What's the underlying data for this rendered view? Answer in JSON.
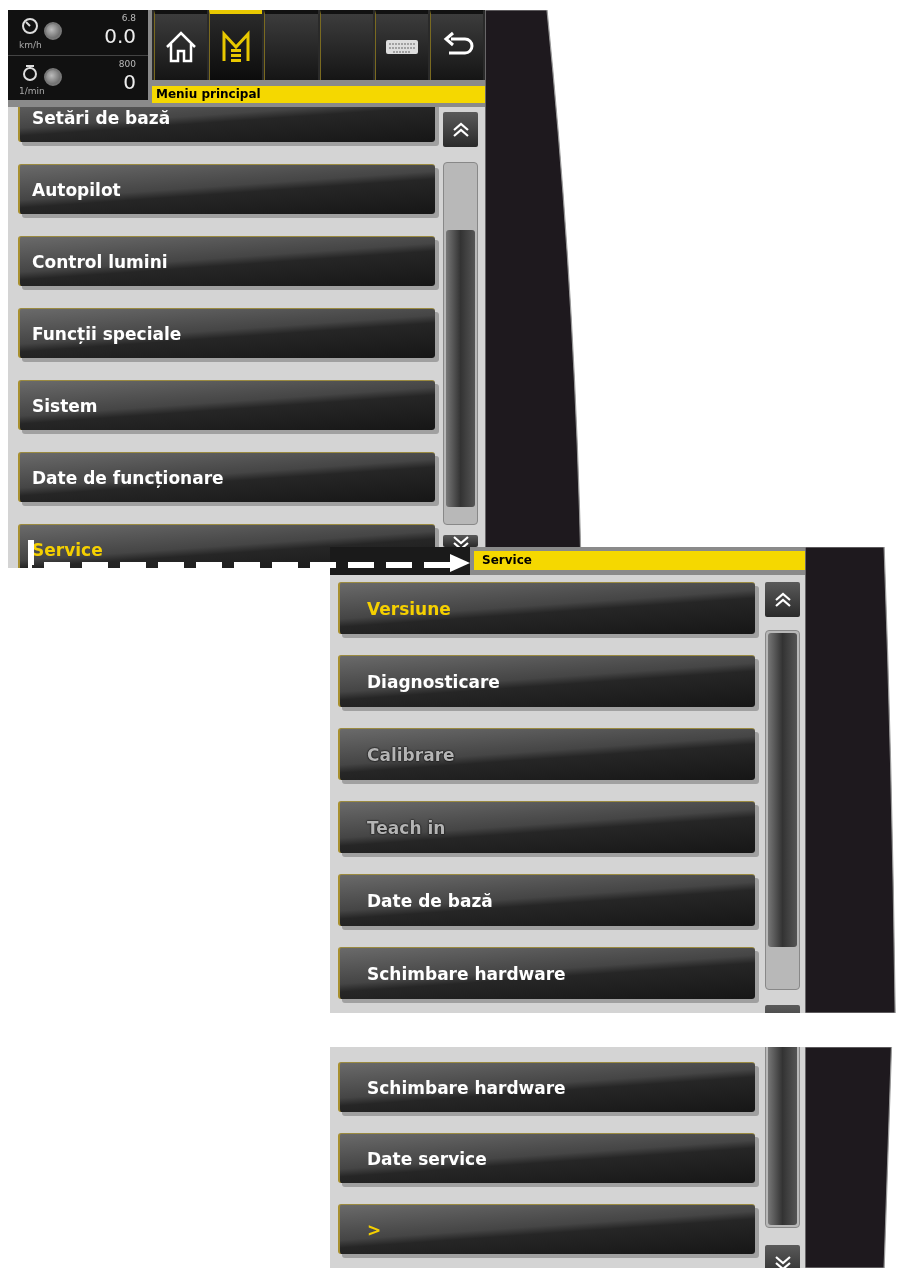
{
  "panels": [
    {
      "kind": "main",
      "gauges": [
        {
          "kind": "speed",
          "limit": "6.8",
          "value": "0.0",
          "unit": "km/h"
        },
        {
          "kind": "engine",
          "limit": "800",
          "value": "0",
          "unit": "1/min"
        }
      ],
      "toolbar": [
        {
          "kind": "home",
          "selected": false
        },
        {
          "kind": "menu",
          "selected": true
        },
        {
          "kind": "empty",
          "selected": false
        },
        {
          "kind": "empty",
          "selected": false
        },
        {
          "kind": "keyboard",
          "selected": false
        },
        {
          "kind": "back",
          "selected": false
        }
      ],
      "title": "Meniu principal",
      "scroll_up": true,
      "scroll_down": true,
      "items": [
        {
          "label": "Setări de bază",
          "selected": false,
          "disabled": false
        },
        {
          "label": "Autopilot",
          "selected": false,
          "disabled": false
        },
        {
          "label": "Control lumini",
          "selected": false,
          "disabled": false
        },
        {
          "label": "Funcții speciale",
          "selected": false,
          "disabled": false
        },
        {
          "label": "Sistem",
          "selected": false,
          "disabled": false
        },
        {
          "label": "Date de funcționare",
          "selected": false,
          "disabled": false
        },
        {
          "label": "Service",
          "selected": true,
          "disabled": false
        }
      ]
    },
    {
      "kind": "sub",
      "title": "Service",
      "scroll_up": true,
      "scroll_down": true,
      "items": [
        {
          "label": "Versiune",
          "selected": true,
          "disabled": false
        },
        {
          "label": "Diagnosticare",
          "selected": false,
          "disabled": false
        },
        {
          "label": "Calibrare",
          "selected": false,
          "disabled": true
        },
        {
          "label": "Teach in",
          "selected": false,
          "disabled": true
        },
        {
          "label": "Date de bază",
          "selected": false,
          "disabled": false
        },
        {
          "label": "Schimbare hardware",
          "selected": false,
          "disabled": false
        }
      ]
    },
    {
      "kind": "cont",
      "scroll_up": false,
      "scroll_down": true,
      "items": [
        {
          "label": "Schimbare hardware",
          "selected": false,
          "disabled": false
        },
        {
          "label": "Date service",
          "selected": false,
          "disabled": false
        },
        {
          "label": ">",
          "selected": true,
          "disabled": false
        }
      ]
    }
  ]
}
